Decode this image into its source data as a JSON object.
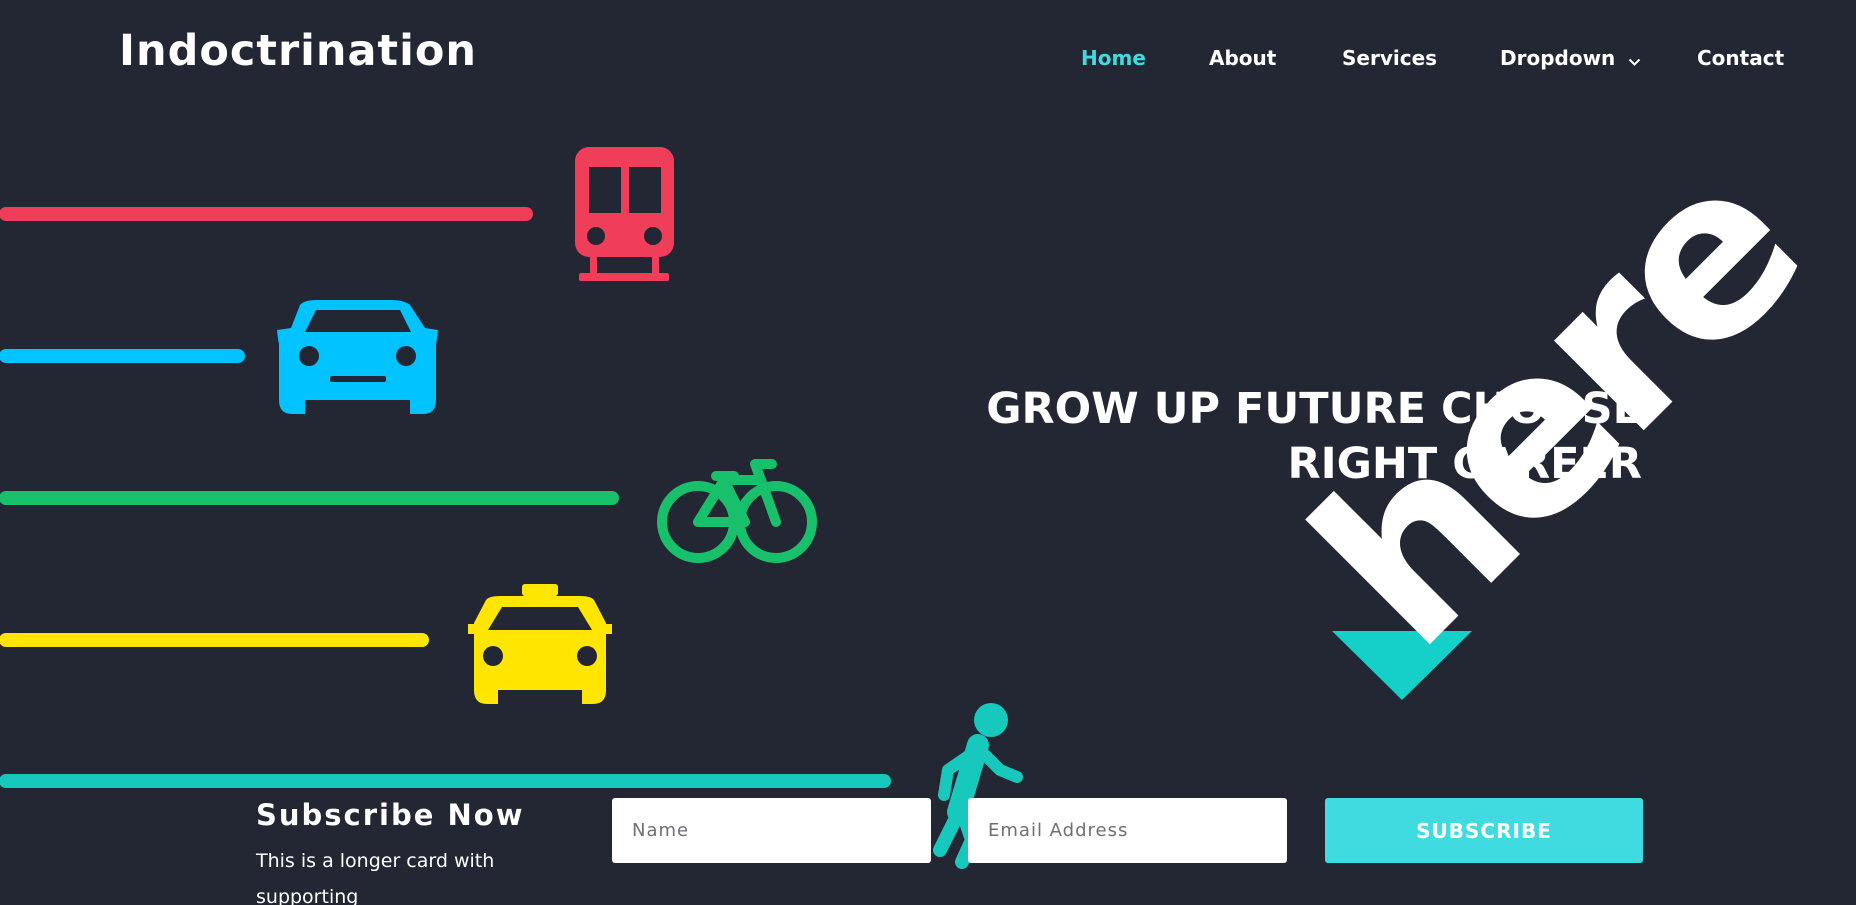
{
  "brand": {
    "name": "Indoctrination"
  },
  "nav": {
    "items": [
      {
        "label": "Home",
        "active": true
      },
      {
        "label": "About",
        "active": false
      },
      {
        "label": "Services",
        "active": false
      },
      {
        "label": "Dropdown",
        "active": false,
        "has_dropdown": true
      },
      {
        "label": "Contact",
        "active": false
      }
    ],
    "active_color": "#3fdbe0"
  },
  "hero": {
    "title_line1": "GROW UP FUTURE CHOOSE",
    "title_line2": "RIGHT CAREER",
    "logo_text": "here",
    "icons": [
      "train-icon",
      "car-icon",
      "bicycle-icon",
      "taxi-icon",
      "pedestrian-icon"
    ],
    "colors": {
      "train": "#ef3d5a",
      "car": "#00c3ff",
      "bicycle": "#19c06b",
      "taxi": "#ffe600",
      "pedestrian": "#17c8bd",
      "here_triangle": "#14d0c9"
    }
  },
  "subscribe": {
    "heading": "Subscribe Now",
    "text": "This is a longer card with supporting",
    "name_placeholder": "Name",
    "email_placeholder": "Email Address",
    "button_label": "SUBSCRIBE",
    "button_color": "#3fdbe0"
  },
  "colors": {
    "background": "#222733"
  }
}
